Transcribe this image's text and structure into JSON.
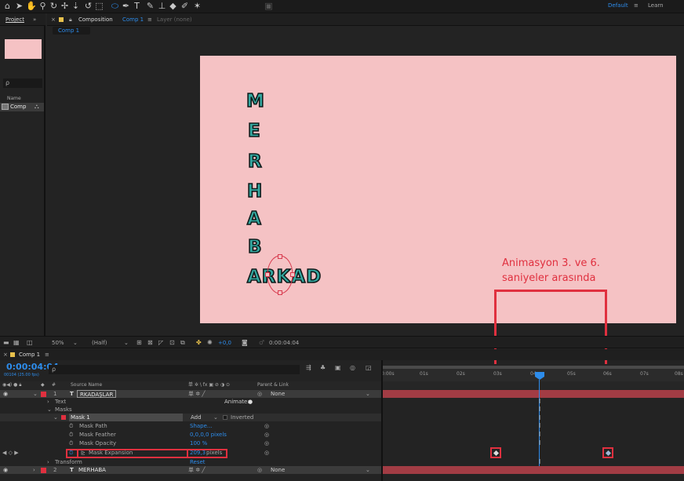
{
  "toolbar": {
    "tools": [
      "home-icon",
      "selection-icon",
      "hand-icon",
      "zoom-icon",
      "orbit-icon",
      "pan-icon",
      "dolly-icon",
      "rotate-icon",
      "region-icon",
      "ellipse-mask-icon",
      "pen-icon",
      "type-icon",
      "brush-icon",
      "stamp-icon",
      "eraser-icon",
      "roto-icon",
      "puppet-icon",
      "snap-icon"
    ],
    "workspace": "Default",
    "workspace_menu": "≡",
    "learn": "Learn"
  },
  "project_panel": {
    "tab": "Project",
    "expand": "»",
    "search_icon": "ρ",
    "column_name": "Name",
    "item": "Comp"
  },
  "comp_panel": {
    "close": "×",
    "lock": "🔒",
    "title_prefix": "Composition",
    "title_name": "Comp 1",
    "menu": "≡",
    "layer_tab": "Layer (none)",
    "sub_tab": "Comp 1",
    "canvas_color": "#f5c2c4",
    "letters": [
      "M",
      "E",
      "R",
      "H",
      "A",
      "B",
      "A"
    ],
    "bottom_word": "ARKAD",
    "zoom": "50%",
    "resolution": "(Half)",
    "exposure": "+0,0",
    "timecode_small": "0:00:04:04"
  },
  "annotation": {
    "line1": "Animasyon 3. ve 6.",
    "line2": "saniyeler arasında",
    "color": "#e0303f"
  },
  "timeline": {
    "tab": "Comp 1",
    "menu": "≡",
    "timecode": "0:00:04:04",
    "fps": "00104 (25.00 fps)",
    "search_icon": "ρ",
    "col_source": "Source Name",
    "col_switches": "单 ✲ \\ fx ▣ ⊘ ◑ ⊙",
    "col_parent": "Parent & Link",
    "ruler": [
      "0:00s",
      "01s",
      "02s",
      "03s",
      "04s",
      "05s",
      "06s",
      "07s",
      "08s"
    ],
    "layers": [
      {
        "num": "1",
        "type": "T",
        "name": "RKADAŞLAR",
        "parent": "None"
      },
      {
        "num": "2",
        "type": "T",
        "name": "MERHABA",
        "parent": "None"
      }
    ],
    "text_group": "Text",
    "animate_label": "Animate:",
    "masks_group": "Masks",
    "mask_name": "Mask 1",
    "mask_mode": "Add",
    "inverted": "Inverted",
    "mask_path": "Mask Path",
    "mask_path_val": "Shape...",
    "mask_feather": "Mask Feather",
    "mask_feather_val": "0,0,0,0 pixels",
    "mask_opacity": "Mask Opacity",
    "mask_opacity_val": "100 %",
    "mask_expansion": "Mask Expansion",
    "mask_expansion_val": "209,3",
    "mask_expansion_unit": "pixels",
    "transform": "Transform",
    "reset": "Reset"
  }
}
